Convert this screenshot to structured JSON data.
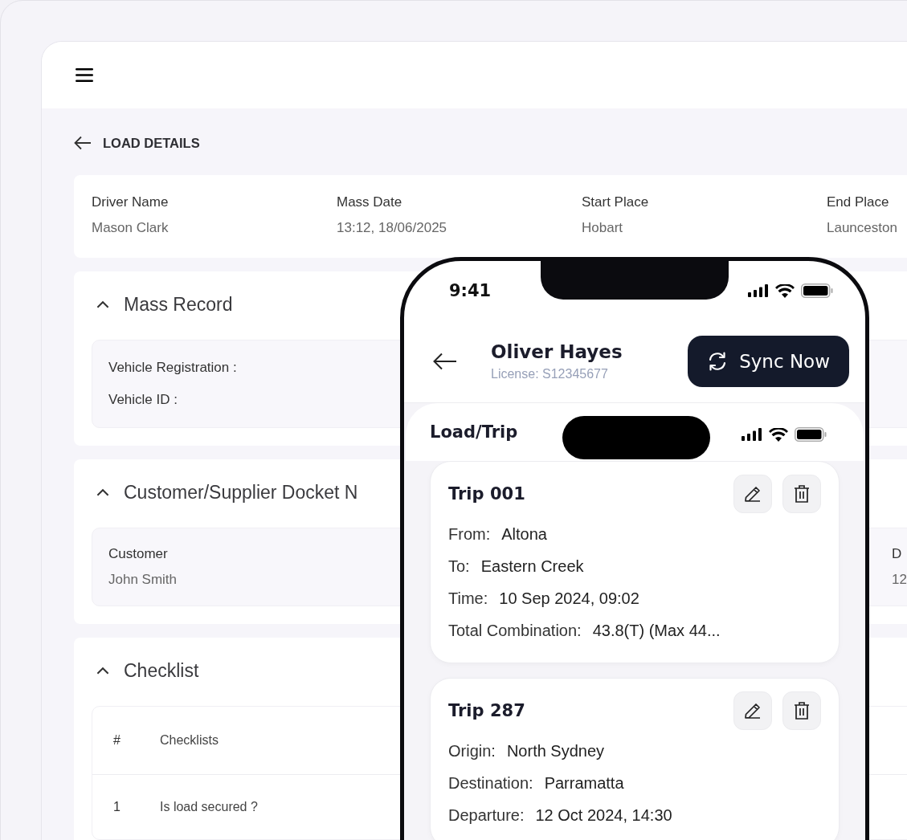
{
  "page_title": "LOAD DETAILS",
  "summary": [
    {
      "label": "Driver Name",
      "value": "Mason Clark"
    },
    {
      "label": "Mass Date",
      "value": "13:12, 18/06/2025"
    },
    {
      "label": "Start Place",
      "value": "Hobart"
    },
    {
      "label": "End Place",
      "value": "Launceston"
    }
  ],
  "sections": [
    {
      "kind": "fields",
      "title": "Mass Record",
      "expanded": true,
      "fields": [
        "Vehicle Registration :",
        "Vehicle ID :"
      ]
    },
    {
      "kind": "details",
      "title": "Customer/Supplier Docket N",
      "expanded": true,
      "details": [
        {
          "label": "Customer",
          "value": "John Smith"
        },
        {
          "label": "D",
          "value": "12"
        }
      ]
    },
    {
      "kind": "table",
      "title": "Checklist",
      "expanded": true,
      "columns": [
        "#",
        "Checklists"
      ],
      "rows": [
        [
          "1",
          "Is load secured ?"
        ]
      ]
    }
  ],
  "phone": {
    "status_time": "9:41",
    "driver_name": "Oliver Hayes",
    "license": "License: S12345677",
    "sync_button": "Sync Now",
    "list_title": "Load/Trip",
    "trips": [
      {
        "title": "Trip 001",
        "fields": [
          {
            "label": "From:",
            "value": "Altona"
          },
          {
            "label": "To:",
            "value": "Eastern Creek"
          },
          {
            "label": "Time:",
            "value": "10 Sep 2024, 09:02"
          },
          {
            "label": "Total Combination:",
            "value": "43.8(T) (Max 44..."
          }
        ]
      },
      {
        "title": "Trip 287",
        "fields": [
          {
            "label": "Origin:",
            "value": "North Sydney"
          },
          {
            "label": "Destination:",
            "value": "Parramatta"
          },
          {
            "label": "Departure:",
            "value": "12 Oct 2024, 14:30"
          }
        ]
      }
    ]
  }
}
